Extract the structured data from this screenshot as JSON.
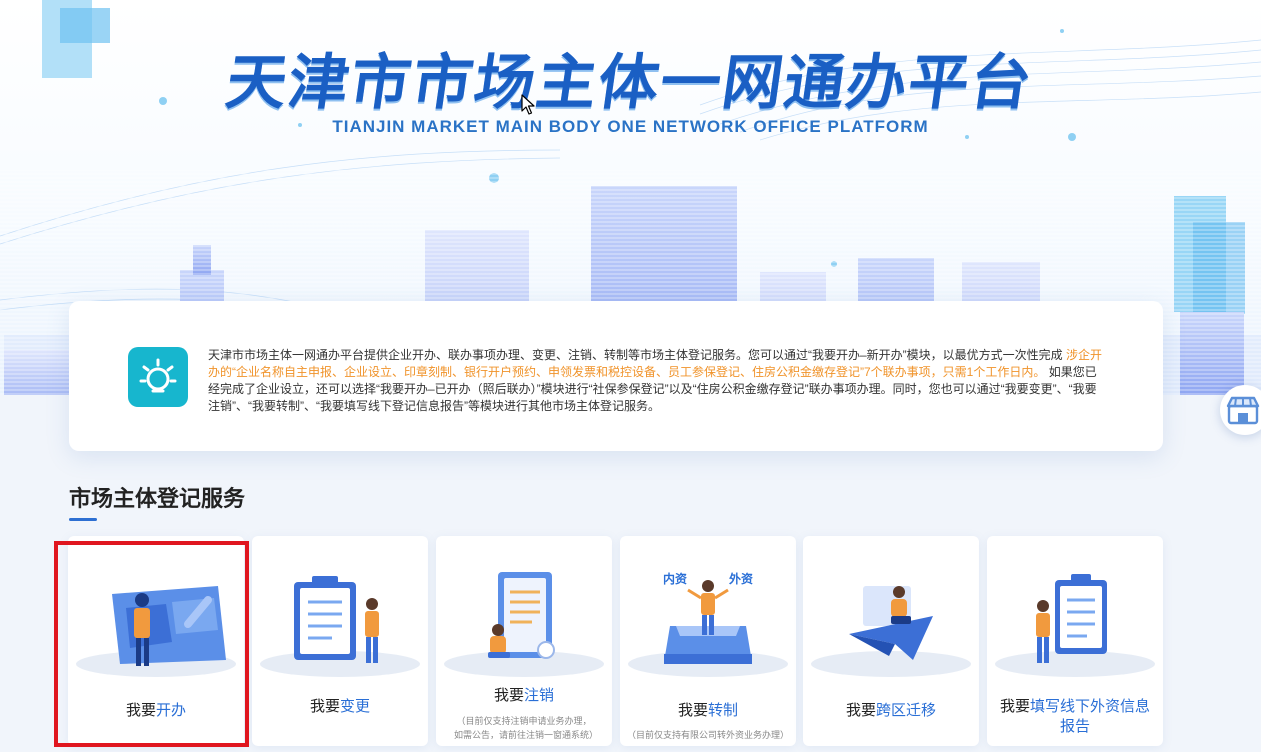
{
  "header": {
    "title": "天津市市场主体一网通办平台",
    "subtitle": "TIANJIN MARKET MAIN BODY ONE NETWORK OFFICE PLATFORM"
  },
  "intro": {
    "icon": "lightbulb-icon",
    "text_part1": "天津市市场主体一网通办平台提供企业开办、联办事项办理、变更、注销、转制等市场主体登记服务。您可以通过“我要开办–新开办”模块，以最优方式一次性完成 ",
    "text_highlight": "涉企开办的“企业名称自主申报、企业设立、印章刻制、银行开户预约、申领发票和税控设备、员工参保登记、住房公积金缴存登记”7个联办事项，只需1个工作日内。",
    "text_part2": " 如果您已经完成了企业设立，还可以选择“我要开办–已开办（照后联办）”模块进行“社保参保登记”以及“住房公积金缴存登记”联办事项办理。同时，您也可以通过“我要变更”、“我要注销”、“我要转制”、“我要填写线下登记信息报告”等模块进行其他市场主体登记服务。"
  },
  "section": {
    "title": "市场主体登记服务"
  },
  "services": [
    {
      "prefix": "我要",
      "highlight": "开办"
    },
    {
      "prefix": "我要",
      "highlight": "变更"
    },
    {
      "prefix": "我要",
      "highlight": "注销",
      "note": "（目前仅支持注销申请业务办理，如需公告，请前往注销一窗通系统）"
    },
    {
      "prefix": "我要",
      "highlight": "转制",
      "tag_left": "内资",
      "tag_right": "外资",
      "note": "（目前仅支持有限公司转外资业务办理）"
    },
    {
      "prefix": "我要",
      "highlight": "跨区迁移"
    },
    {
      "prefix": "我要",
      "highlight_line1": "填写线下外资信息",
      "highlight_line2": "报告"
    }
  ],
  "colors": {
    "brand_blue": "#1a5fc4",
    "accent_orange": "#f0932a",
    "link_blue": "#2a6fd6",
    "highlight_red": "#e0161f",
    "intro_icon_bg": "#17b6ce"
  }
}
